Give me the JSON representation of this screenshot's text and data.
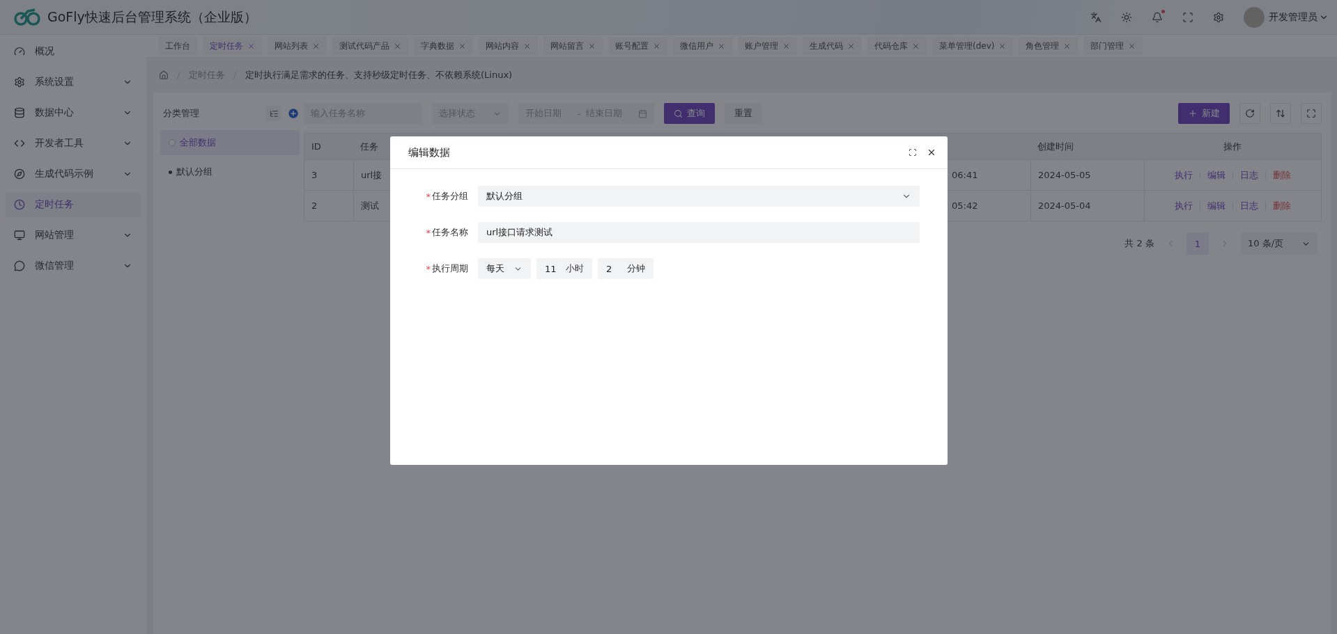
{
  "app": {
    "title": "GoFly快速后台管理系统（企业版）",
    "user": "开发管理员",
    "notification_dot": true
  },
  "sidebar": {
    "items": [
      {
        "label": "概况",
        "expandable": false,
        "selected": false
      },
      {
        "label": "系统设置",
        "expandable": true,
        "selected": false
      },
      {
        "label": "数据中心",
        "expandable": true,
        "selected": false
      },
      {
        "label": "开发者工具",
        "expandable": true,
        "selected": false
      },
      {
        "label": "生成代码示例",
        "expandable": true,
        "selected": false
      },
      {
        "label": "定时任务",
        "expandable": false,
        "selected": true
      },
      {
        "label": "网站管理",
        "expandable": true,
        "selected": false
      },
      {
        "label": "微信管理",
        "expandable": true,
        "selected": false
      }
    ]
  },
  "tabs": [
    {
      "label": "工作台",
      "closable": false,
      "selected": false
    },
    {
      "label": "定时任务",
      "closable": true,
      "selected": true
    },
    {
      "label": "网站列表",
      "closable": true,
      "selected": false
    },
    {
      "label": "测试代码产品",
      "closable": true,
      "selected": false
    },
    {
      "label": "字典数据",
      "closable": true,
      "selected": false
    },
    {
      "label": "网站内容",
      "closable": true,
      "selected": false
    },
    {
      "label": "网站留言",
      "closable": true,
      "selected": false
    },
    {
      "label": "账号配置",
      "closable": true,
      "selected": false
    },
    {
      "label": "微信用户",
      "closable": true,
      "selected": false
    },
    {
      "label": "账户管理",
      "closable": true,
      "selected": false
    },
    {
      "label": "生成代码",
      "closable": true,
      "selected": false
    },
    {
      "label": "代码仓库",
      "closable": true,
      "selected": false
    },
    {
      "label": "菜单管理(dev)",
      "closable": true,
      "selected": false
    },
    {
      "label": "角色管理",
      "closable": true,
      "selected": false
    },
    {
      "label": "部门管理",
      "closable": true,
      "selected": false
    }
  ],
  "breadcrumb": [
    "定时任务",
    "定时执行满足需求的任务、支持秒级定时任务、不依赖系统(Linux)"
  ],
  "categories": {
    "title": "分类管理",
    "items": [
      {
        "label": "全部数据",
        "selected": true
      },
      {
        "label": "默认分组",
        "selected": false
      }
    ]
  },
  "filters": {
    "name_placeholder": "输入任务名称",
    "status_placeholder": "选择状态",
    "start_placeholder": "开始日期",
    "range_separator": "-",
    "end_placeholder": "结束日期",
    "search_button": "查询",
    "reset_button": "重置",
    "create_button": "新建"
  },
  "table": {
    "columns": [
      "ID",
      "任务",
      "创建时间",
      "操作"
    ],
    "rows": [
      {
        "id": "3",
        "name": "url接",
        "time": "06:41",
        "created": "2024-05-05",
        "actions": [
          {
            "label": "执行",
            "kind": "link"
          },
          {
            "label": "编辑",
            "kind": "link"
          },
          {
            "label": "日志",
            "kind": "link"
          },
          {
            "label": "删除",
            "kind": "danger"
          }
        ]
      },
      {
        "id": "2",
        "name": "测试",
        "time": "05:42",
        "created": "2024-05-04",
        "actions": [
          {
            "label": "执行",
            "kind": "link"
          },
          {
            "label": "编辑",
            "kind": "link"
          },
          {
            "label": "日志",
            "kind": "link"
          },
          {
            "label": "删除",
            "kind": "danger"
          }
        ]
      }
    ]
  },
  "pagination": {
    "total": "共 2 条",
    "pages": [
      {
        "label": "1",
        "selected": true
      }
    ],
    "page_size": "10 条/页"
  },
  "modal": {
    "title": "编辑数据",
    "fields": [
      {
        "kind": "select",
        "label": "任务分组",
        "required_mark": "*",
        "value": "默认分组"
      },
      {
        "kind": "input",
        "label": "任务名称",
        "required_mark": "*",
        "value": "url接口请求测试"
      },
      {
        "kind": "period",
        "label": "执行周期",
        "required_mark": "*",
        "period": "每天",
        "hour": "11",
        "hour_unit": "小时",
        "minute": "2",
        "minute_unit": "分钟"
      }
    ]
  }
}
